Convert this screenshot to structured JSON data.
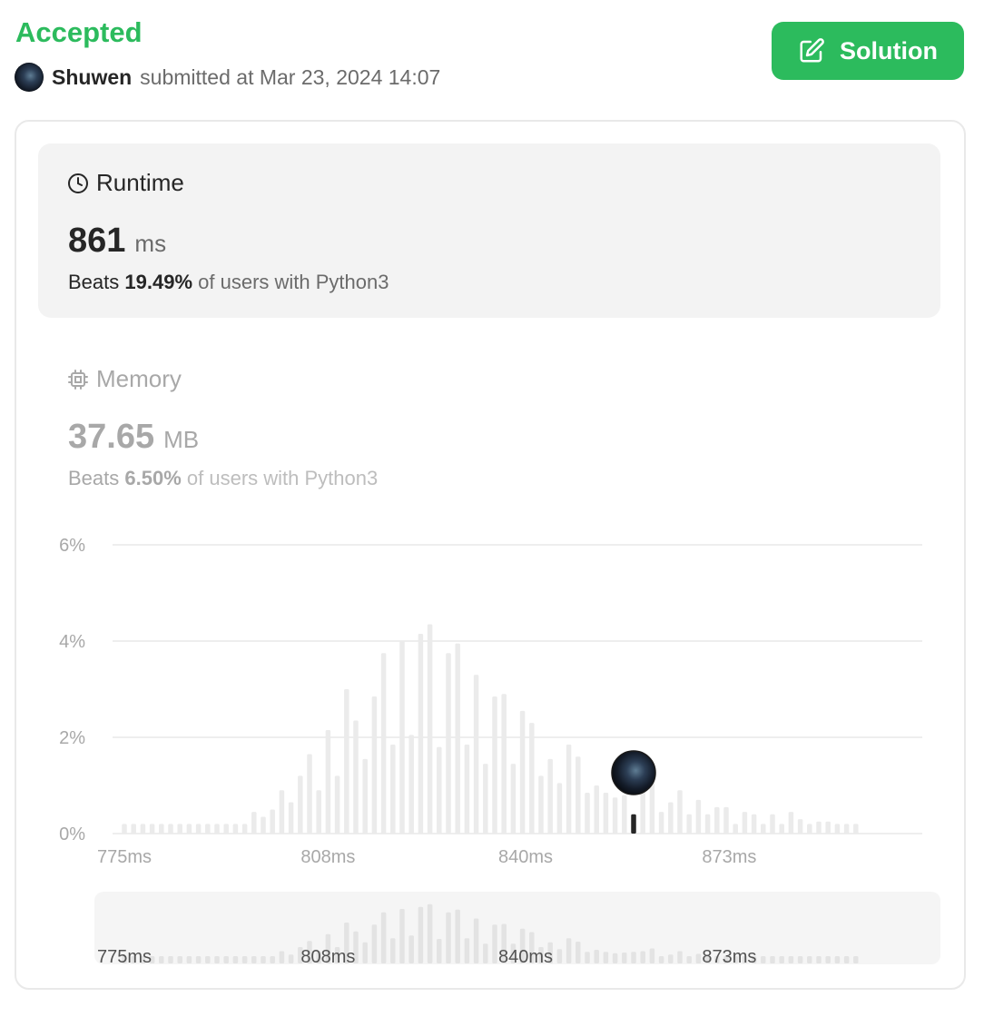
{
  "header": {
    "status": "Accepted",
    "username": "Shuwen",
    "submitted_text": "submitted at Mar 23, 2024 14:07",
    "solution_label": "Solution"
  },
  "runtime": {
    "title": "Runtime",
    "value": "861",
    "unit": "ms",
    "beats_lead": "Beats",
    "beats_pct": "19.49%",
    "beats_rest": "of users with Python3"
  },
  "memory": {
    "title": "Memory",
    "value": "37.65",
    "unit": "MB",
    "beats_lead": "Beats",
    "beats_pct": "6.50%",
    "beats_rest": "of users with Python3"
  },
  "icons": {
    "solution": "edit-icon",
    "runtime": "clock-icon",
    "memory": "cpu-chip-icon",
    "user": "avatar"
  },
  "colors": {
    "accent": "#2cbb5d",
    "bar": "#ebebeb",
    "highlight_bar": "#262626",
    "grid": "#e8e8e8"
  },
  "chart_data": {
    "type": "bar",
    "y_ticks": [
      "6%",
      "4%",
      "2%",
      "0%"
    ],
    "y_tick_values": [
      6,
      4,
      2,
      0
    ],
    "ylim": [
      0,
      6
    ],
    "x_ticks": [
      "775ms",
      "808ms",
      "840ms",
      "873ms"
    ],
    "x_tick_values": [
      775,
      808,
      840,
      873
    ],
    "x_start": 775,
    "x_step": 1.5,
    "grid": true,
    "values": [
      0.2,
      0.2,
      0.2,
      0.2,
      0.2,
      0.2,
      0.2,
      0.2,
      0.2,
      0.2,
      0.2,
      0.2,
      0.2,
      0.2,
      0.45,
      0.35,
      0.5,
      0.9,
      0.65,
      1.2,
      1.65,
      0.9,
      2.15,
      1.2,
      3.0,
      2.35,
      1.55,
      2.85,
      3.75,
      1.85,
      4.0,
      2.05,
      4.15,
      4.35,
      1.8,
      3.75,
      3.95,
      1.85,
      3.3,
      1.45,
      2.85,
      2.9,
      1.45,
      2.55,
      2.3,
      1.2,
      1.55,
      1.05,
      1.85,
      1.6,
      0.85,
      1.0,
      0.85,
      0.75,
      0.8,
      0.85,
      0.9,
      1.1,
      0.45,
      0.65,
      0.9,
      0.4,
      0.7,
      0.4,
      0.55,
      0.55,
      0.2,
      0.45,
      0.4,
      0.2,
      0.4,
      0.2,
      0.45,
      0.3,
      0.2,
      0.25,
      0.25,
      0.2,
      0.2,
      0.2
    ],
    "highlight_index": 55,
    "highlight_value": 0.4,
    "highlight_label": "861ms"
  }
}
